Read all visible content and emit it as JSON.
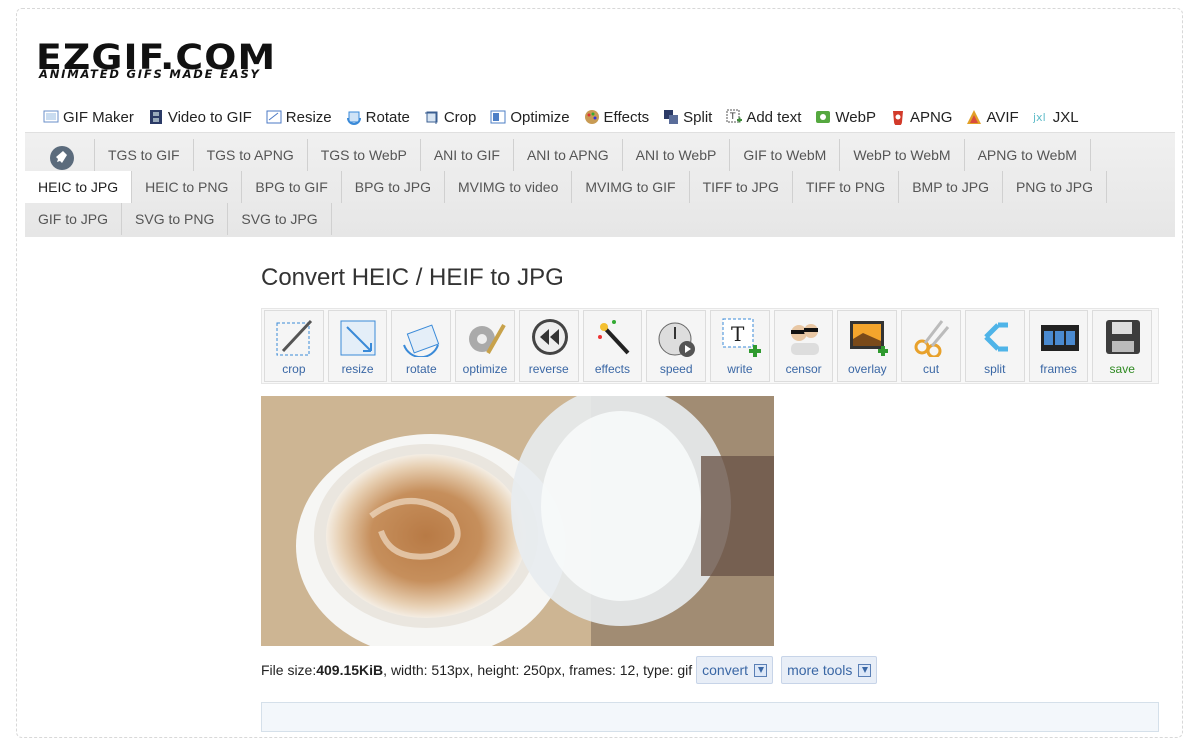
{
  "logo": {
    "main": "EZGIF.COM",
    "tagline": "ANIMATED GIFS MADE EASY"
  },
  "topnav": [
    {
      "label": "GIF Maker",
      "icon": "gif-maker-icon",
      "color": "#6a8fc9"
    },
    {
      "label": "Video to GIF",
      "icon": "film-icon",
      "color": "#2b3a66"
    },
    {
      "label": "Resize",
      "icon": "resize-icon",
      "color": "#4b79c4"
    },
    {
      "label": "Rotate",
      "icon": "rotate-icon",
      "color": "#3a8ad8"
    },
    {
      "label": "Crop",
      "icon": "crop-icon",
      "color": "#3b5f92"
    },
    {
      "label": "Optimize",
      "icon": "optimize-icon",
      "color": "#4d7fc6"
    },
    {
      "label": "Effects",
      "icon": "effects-icon",
      "color": "#c89b54"
    },
    {
      "label": "Split",
      "icon": "split-icon",
      "color": "#2b3a66"
    },
    {
      "label": "Add text",
      "icon": "add-text-icon",
      "color": "#3f8a3b"
    },
    {
      "label": "WebP",
      "icon": "webp-icon",
      "color": "#55a83f"
    },
    {
      "label": "APNG",
      "icon": "apng-icon",
      "color": "#d23a2a"
    },
    {
      "label": "AVIF",
      "icon": "avif-icon",
      "color": "#e2a027"
    },
    {
      "label": "JXL",
      "icon": "jxl-icon",
      "color": "#5fbcc9"
    }
  ],
  "subnav": {
    "rows": [
      [
        "TGS to GIF",
        "TGS to APNG",
        "TGS to WebP",
        "ANI to GIF",
        "ANI to APNG",
        "ANI to WebP",
        "GIF to WebM",
        "WebP to WebM",
        "APNG to WebM"
      ],
      [
        "HEIC to JPG",
        "HEIC to PNG",
        "BPG to GIF",
        "BPG to JPG",
        "MVIMG to video",
        "MVIMG to GIF",
        "TIFF to JPG",
        "TIFF to PNG",
        "BMP to JPG",
        "PNG to JPG"
      ],
      [
        "GIF to JPG",
        "SVG to PNG",
        "SVG to JPG"
      ]
    ],
    "active": "HEIC to JPG"
  },
  "page_title": "Convert HEIC / HEIF to JPG",
  "tools": [
    {
      "label": "crop",
      "icon": "crop-tool-icon"
    },
    {
      "label": "resize",
      "icon": "resize-tool-icon"
    },
    {
      "label": "rotate",
      "icon": "rotate-tool-icon"
    },
    {
      "label": "optimize",
      "icon": "optimize-tool-icon"
    },
    {
      "label": "reverse",
      "icon": "reverse-tool-icon"
    },
    {
      "label": "effects",
      "icon": "effects-tool-icon"
    },
    {
      "label": "speed",
      "icon": "speed-tool-icon"
    },
    {
      "label": "write",
      "icon": "write-tool-icon"
    },
    {
      "label": "censor",
      "icon": "censor-tool-icon"
    },
    {
      "label": "overlay",
      "icon": "overlay-tool-icon"
    },
    {
      "label": "cut",
      "icon": "cut-tool-icon"
    },
    {
      "label": "split",
      "icon": "split-tool-icon"
    },
    {
      "label": "frames",
      "icon": "frames-tool-icon"
    },
    {
      "label": "save",
      "icon": "save-tool-icon"
    }
  ],
  "fileinfo": {
    "label": "File size: ",
    "size": "409.15KiB",
    "rest": ", width: 513px, height: 250px, frames: 12, type: gif"
  },
  "buttons": {
    "convert": "convert",
    "more_tools": "more tools"
  }
}
